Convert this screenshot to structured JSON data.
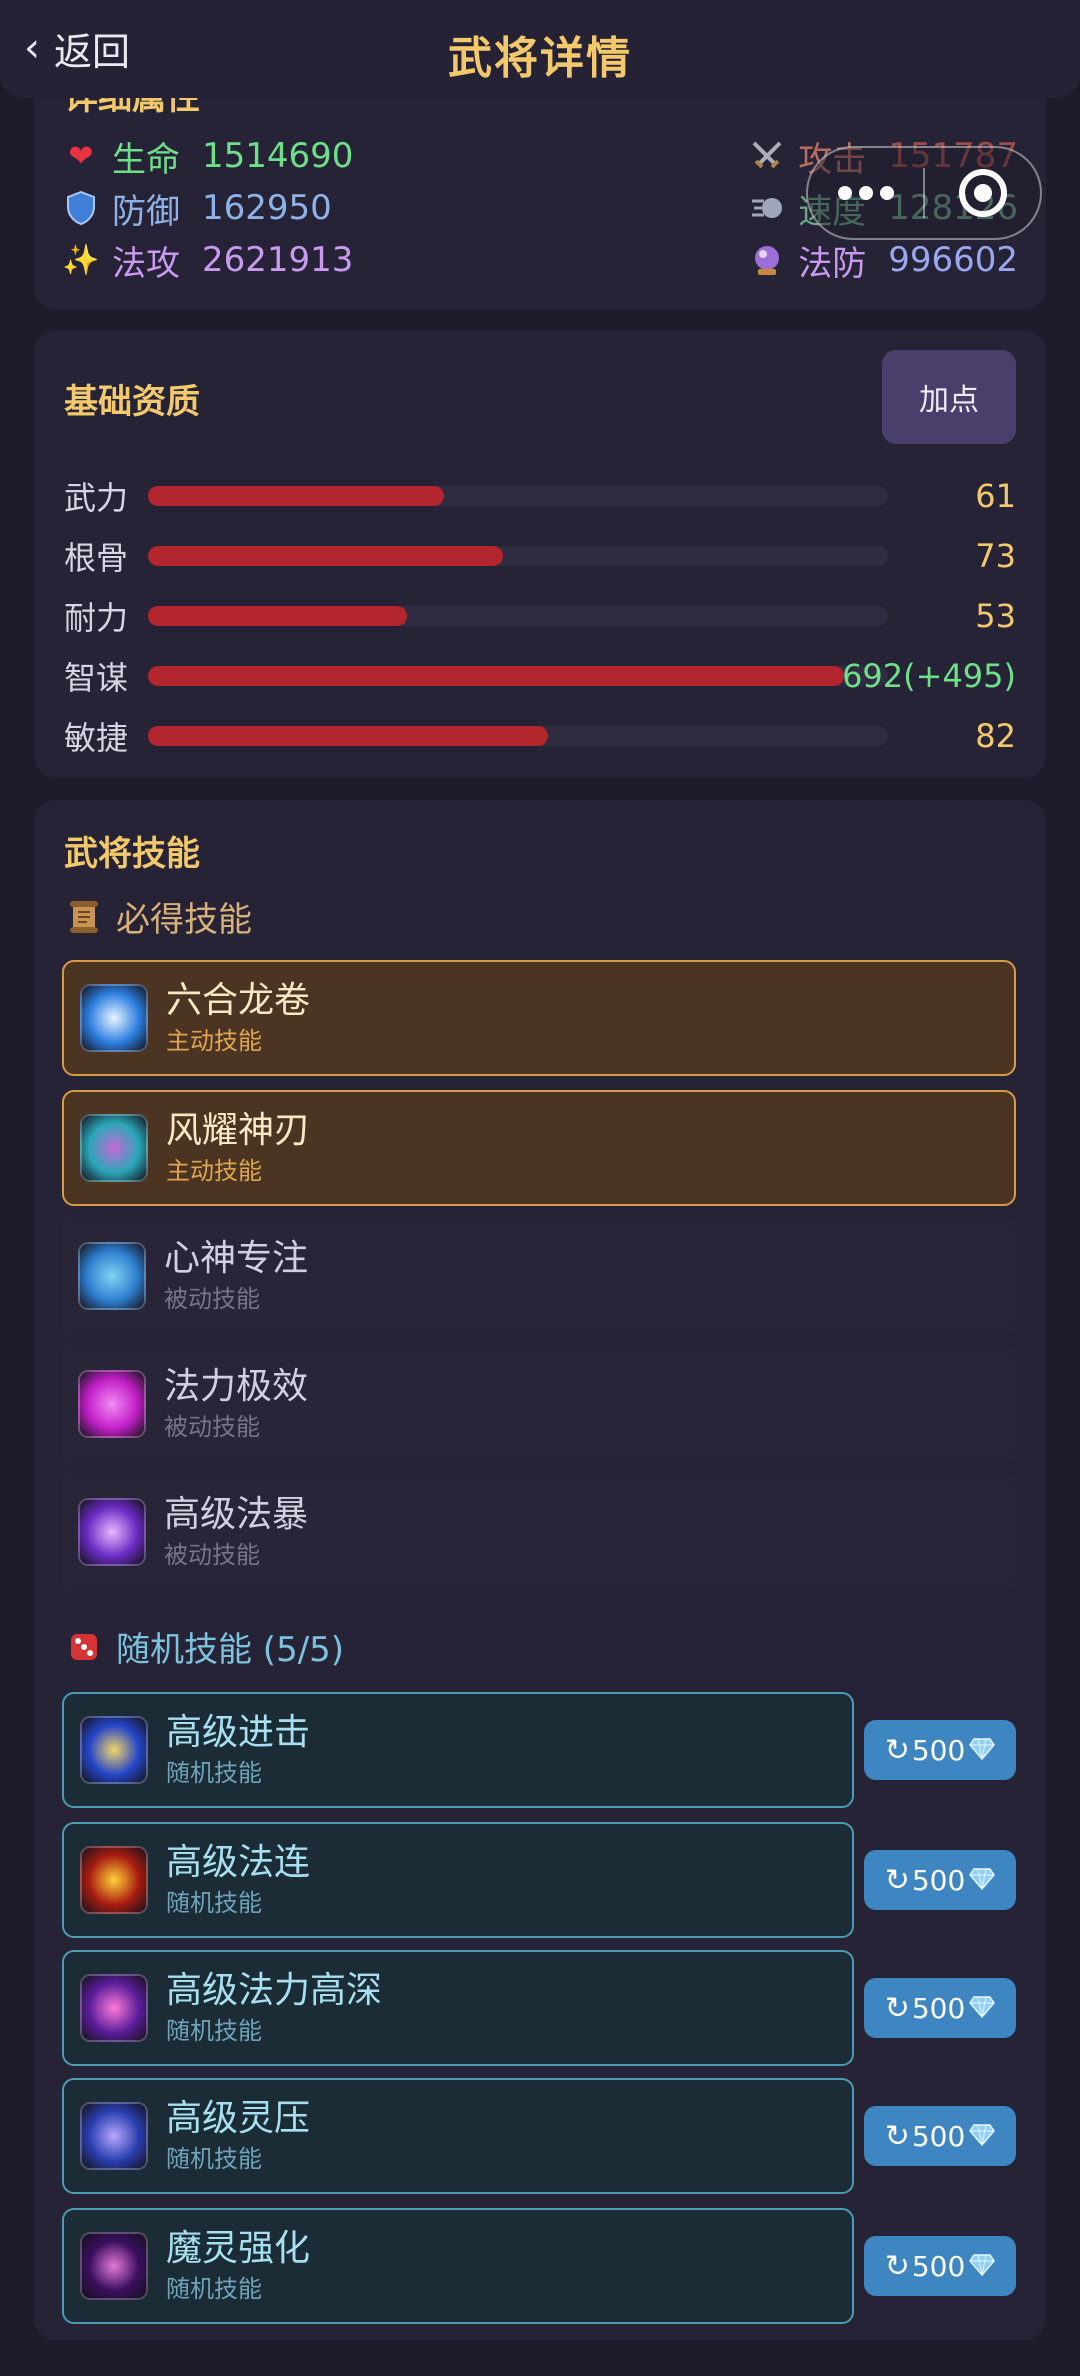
{
  "header": {
    "back_label": "返回",
    "title": "武将详情"
  },
  "attributes": {
    "title": "详细属性",
    "left": [
      {
        "icon": "heart-icon",
        "label": "生命",
        "value": "1514690",
        "color": "#6fe08a",
        "label_color": "#6fe08a",
        "icon_color": "#e8323f"
      },
      {
        "icon": "shield-icon",
        "label": "防御",
        "value": "162950",
        "color": "#8fb3e8",
        "label_color": "#8fb3e8",
        "icon_color": "#3f7fd8"
      },
      {
        "icon": "sparkle-icon",
        "label": "法攻",
        "value": "2621913",
        "color": "#c99af0",
        "label_color": "#c99af0",
        "icon_color": "#f2c23a"
      }
    ],
    "right": [
      {
        "icon": "crossed-swords-icon",
        "label": "攻击",
        "value": "151787",
        "color": "#e8876c",
        "label_color": "#e8876c",
        "icon_color": "#d9a24a"
      },
      {
        "icon": "wind-icon",
        "label": "速度",
        "value": "128126",
        "color": "#7ed49a",
        "label_color": "#7ed49a",
        "icon_color": "#c9d4e8"
      },
      {
        "icon": "crystal-ball-icon",
        "label": "法防",
        "value": "996602",
        "color": "#9aa8f0",
        "label_color": "#c99af0",
        "icon_color": "#9b6fd6"
      }
    ]
  },
  "base": {
    "title": "基础资质",
    "add_label": "加点",
    "stats": [
      {
        "name": "武力",
        "value": "61",
        "fill": 0.4,
        "bonus": false
      },
      {
        "name": "根骨",
        "value": "73",
        "fill": 0.48,
        "bonus": false
      },
      {
        "name": "耐力",
        "value": "53",
        "fill": 0.35,
        "bonus": false
      },
      {
        "name": "智谋",
        "value": "692(+495)",
        "fill": 0.94,
        "bonus": true
      },
      {
        "name": "敏捷",
        "value": "82",
        "fill": 0.54,
        "bonus": false
      }
    ]
  },
  "skills": {
    "title": "武将技能",
    "must_title": "必得技能",
    "random_title": "随机技能 (5/5)",
    "fixed": [
      {
        "name": "六合龙卷",
        "type": "主动技能",
        "kind": "must",
        "icon": "vortex-icon",
        "colors": [
          "#2d7fe0",
          "#e8f4ff"
        ]
      },
      {
        "name": "风耀神刃",
        "type": "主动技能",
        "kind": "must",
        "icon": "tornado-blade-icon",
        "colors": [
          "#2aa7b8",
          "#c46ad8"
        ]
      },
      {
        "name": "心神专注",
        "type": "被动技能",
        "kind": "passive",
        "icon": "meditating-face-icon",
        "colors": [
          "#2f7fd0",
          "#7fd6f0"
        ]
      },
      {
        "name": "法力极效",
        "type": "被动技能",
        "kind": "passive",
        "icon": "magenta-flame-icon",
        "colors": [
          "#c21fc7",
          "#f28cf5"
        ]
      },
      {
        "name": "高级法暴",
        "type": "被动技能",
        "kind": "passive",
        "icon": "purple-orb-icon",
        "colors": [
          "#6a2bc2",
          "#e6b8ff"
        ]
      }
    ],
    "random": [
      {
        "name": "高级进击",
        "type": "随机技能",
        "icon": "dash-strike-icon",
        "colors": [
          "#2546c8",
          "#f2d56a"
        ]
      },
      {
        "name": "高级法连",
        "type": "随机技能",
        "icon": "fire-streak-icon",
        "colors": [
          "#a81c10",
          "#ffd23a"
        ]
      },
      {
        "name": "高级法力高深",
        "type": "随机技能",
        "icon": "glowing-book-icon",
        "colors": [
          "#5b1e9a",
          "#ff7ad9"
        ]
      },
      {
        "name": "高级灵压",
        "type": "随机技能",
        "icon": "spirit-beast-icon",
        "colors": [
          "#2a3fb0",
          "#b8a8ff"
        ]
      },
      {
        "name": "魔灵强化",
        "type": "随机技能",
        "icon": "demon-eye-icon",
        "colors": [
          "#3a0f5e",
          "#e27ad8"
        ]
      }
    ],
    "refresh_cost": "500"
  },
  "colors": {
    "accent_gold": "#f3c96b",
    "bar_red": "#b3262d",
    "refresh_blue": "#3e86c2"
  }
}
